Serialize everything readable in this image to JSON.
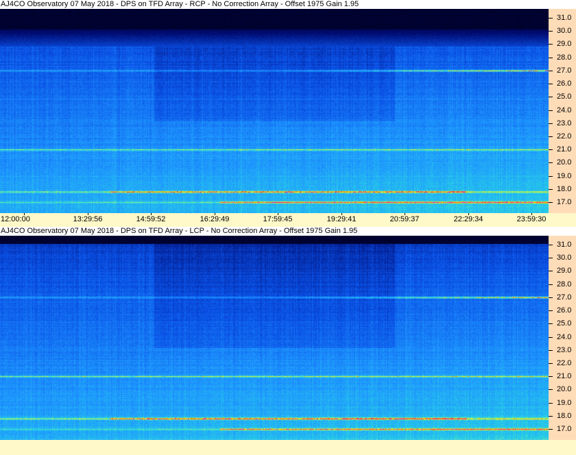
{
  "panels": [
    {
      "title": "AJ4CO Observatory 07 May 2018 - DPS on TFD Array  - RCP  -  No Correction Array  -  Offset 1975  Gain 1.95",
      "polarization": "RCP"
    },
    {
      "title": "AJ4CO Observatory 07 May 2018 - DPS on TFD Array  - LCP  -  No Correction Array  -  Offset 1975  Gain 1.95",
      "polarization": "LCP"
    }
  ],
  "colors": {
    "freq_axis_bg": "#ffdcb8",
    "time_axis_bg": "#fff8c8",
    "spectrogram_low": "#00001e",
    "spectrogram_mid": "#1e78ff",
    "spectrogram_high": "#ffe000"
  },
  "chart_data": [
    {
      "type": "heatmap",
      "title": "AJ4CO Observatory 07 May 2018 - DPS on TFD Array  - RCP  -  No Correction Array  -  Offset 1975  Gain 1.95",
      "x_tick_labels": [
        "12:00:00",
        "13:29:56",
        "14:59:52",
        "16:29:49",
        "17:59:45",
        "19:29:41",
        "20:59:37",
        "22:29:34",
        "23:59:30"
      ],
      "y_tick_labels": [
        "31.0",
        "30.0",
        "29.0",
        "28.0",
        "27.0",
        "26.0",
        "25.0",
        "24.0",
        "23.0",
        "22.0",
        "21.0",
        "20.0",
        "19.0",
        "18.0",
        "17.0"
      ],
      "y_values_mhz": [
        31.0,
        30.0,
        29.0,
        28.0,
        27.0,
        26.0,
        25.0,
        24.0,
        23.0,
        22.0,
        21.0,
        20.0,
        19.0,
        18.0,
        17.0
      ],
      "y_range_mhz": [
        16.5,
        32.0
      ],
      "emission_bands_mhz": [
        27.0,
        21.0,
        17.8,
        17.0
      ]
    },
    {
      "type": "heatmap",
      "title": "AJ4CO Observatory 07 May 2018 - DPS on TFD Array  - LCP  -  No Correction Array  -  Offset 1975  Gain 1.95",
      "y_tick_labels": [
        "31.0",
        "30.0",
        "29.0",
        "28.0",
        "27.0",
        "26.0",
        "25.0",
        "24.0",
        "23.0",
        "22.0",
        "21.0",
        "20.0",
        "19.0",
        "18.0",
        "17.0"
      ],
      "y_values_mhz": [
        31.0,
        30.0,
        29.0,
        28.0,
        27.0,
        26.0,
        25.0,
        24.0,
        23.0,
        22.0,
        21.0,
        20.0,
        19.0,
        18.0,
        17.0
      ],
      "y_range_mhz": [
        16.5,
        32.0
      ],
      "emission_bands_mhz": [
        27.0,
        21.0,
        17.8,
        17.0
      ]
    }
  ]
}
